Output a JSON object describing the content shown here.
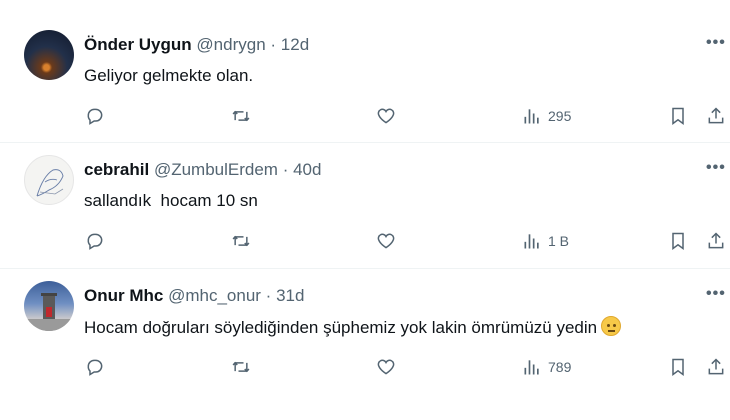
{
  "tweets": [
    {
      "name": "Önder Uygun",
      "handle": "@ndrygn",
      "separator": "·",
      "age": "12d",
      "text": "Geliyor gelmekte olan.",
      "views": "295",
      "more": "•••"
    },
    {
      "name": "cebrahil",
      "handle": "@ZumbulErdem",
      "separator": "·",
      "age": "40d",
      "text": "sallandık  hocam 10 sn",
      "views": "1 B",
      "more": "•••"
    },
    {
      "name": "Onur Mhc",
      "handle": "@mhc_onur",
      "separator": "·",
      "age": "31d",
      "text": "Hocam doğruları söylediğinden şüphemiz yok lakin ömrümüzü yedin",
      "views": "789",
      "more": "•••"
    }
  ],
  "icons": {
    "reply": "reply-icon",
    "retweet": "retweet-icon",
    "like": "heart-icon",
    "views": "views-icon",
    "bookmark": "bookmark-icon",
    "share": "share-icon",
    "emoji": "saluting-face-emoji"
  },
  "colors": {
    "text": "#0f1419",
    "muted": "#536471",
    "divider": "#eff3f4"
  }
}
